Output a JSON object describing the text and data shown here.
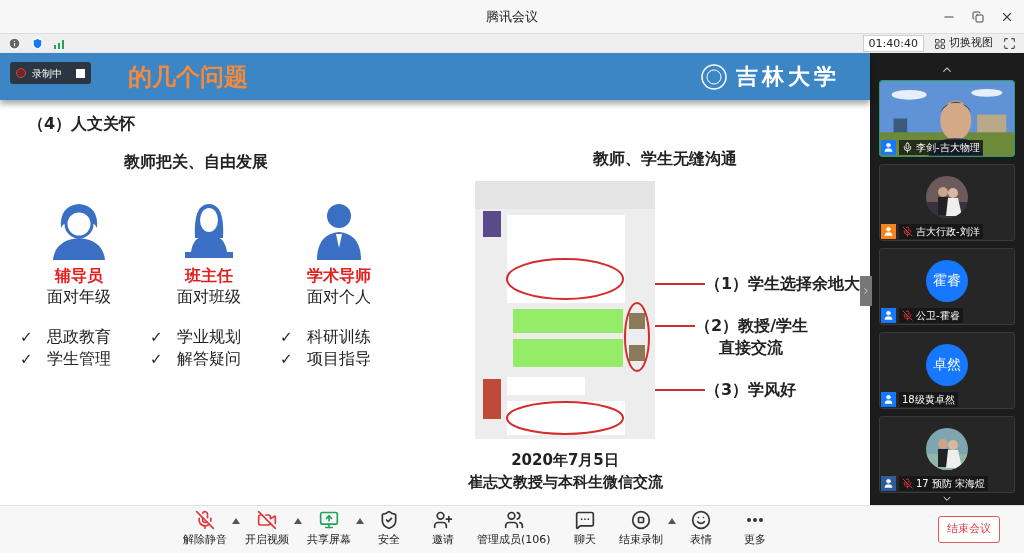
{
  "window": {
    "title": "腾讯会议"
  },
  "status_bar": {
    "timer": "01:40:40",
    "view_switch": "切换视图"
  },
  "recording": {
    "label": "录制中"
  },
  "slide": {
    "title": "的几个问题",
    "logo": "吉林大学",
    "section": "（4）人文关怀",
    "left_heading": "教师把关、自由发展",
    "roles": [
      {
        "title": "辅导员",
        "scope": "面对年级",
        "kind": "counselor",
        "duties": [
          {
            "mark": "✓",
            "text": "思政教育"
          },
          {
            "mark": "✓",
            "text": "学生管理"
          }
        ]
      },
      {
        "title": "班主任",
        "scope": "面对班级",
        "kind": "teacher",
        "duties": [
          {
            "mark": "✓",
            "text": "学业规划"
          },
          {
            "mark": "✓",
            "text": "解答疑问"
          }
        ]
      },
      {
        "title": "学术导师",
        "scope": "面对个人",
        "kind": "advisor",
        "duties": [
          {
            "mark": "✓",
            "text": "科研训练"
          },
          {
            "mark": "✓",
            "text": "项目指导"
          }
        ]
      }
    ],
    "right_heading": "教师、学生无缝沟通",
    "callouts": [
      {
        "lines": [
          "（1）学生选择余地大"
        ]
      },
      {
        "lines": [
          "（2）教授/学生",
          "直接交流"
        ]
      },
      {
        "lines": [
          "（3）学风好"
        ]
      }
    ],
    "caption": [
      "2020年7月5日",
      "崔志文教授与本科生微信交流"
    ]
  },
  "participants": [
    {
      "name": "李剑-吉大物理",
      "kind": "video",
      "muted": false,
      "color": "#1677ff"
    },
    {
      "name": "吉大行政-刘洋",
      "muted": true,
      "color": "#f5841f"
    },
    {
      "name": "公卫-霍睿",
      "kind": "initials",
      "initials": "霍睿",
      "muted": true,
      "color": "#1677ff"
    },
    {
      "name": "18级黄卓然",
      "kind": "initials",
      "initials": "卓然",
      "color": "#1677ff"
    },
    {
      "name": "17 预防 宋海煜",
      "muted": true,
      "color": "#2f5d9a"
    }
  ],
  "toolbar": [
    {
      "label": "解除静音",
      "kind": "mic-off",
      "caret": true
    },
    {
      "label": "开启视频",
      "kind": "video-off",
      "caret": true
    },
    {
      "label": "共享屏幕",
      "kind": "share",
      "caret": true
    },
    {
      "label": "安全",
      "kind": "shield",
      "caret": false
    },
    {
      "label": "邀请",
      "kind": "invite",
      "caret": false
    },
    {
      "label": "管理成员(106)",
      "kind": "members",
      "caret": false
    },
    {
      "label": "聊天",
      "kind": "chat",
      "caret": false
    },
    {
      "label": "结束录制",
      "kind": "stop",
      "caret": true
    },
    {
      "label": "表情",
      "kind": "emoji",
      "caret": false
    },
    {
      "label": "更多",
      "kind": "more",
      "caret": false
    }
  ],
  "end_button": "结束会议"
}
